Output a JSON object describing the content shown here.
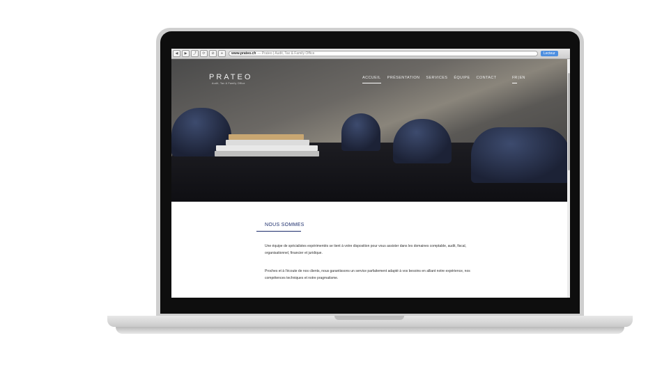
{
  "browser": {
    "url_site": "www.prateo.ch",
    "url_title": "— Prateo | Audit, Tax & Family Office",
    "reader_label": "Lecteur",
    "buttons": [
      "◀",
      "▶",
      "⤴",
      "⟳",
      "⊘",
      "+"
    ]
  },
  "site": {
    "logo": "PRATEO",
    "tagline": "Audit, Tax & Family Office",
    "nav": [
      "ACCUEIL",
      "PRÉSENTATION",
      "SERVICES",
      "ÉQUIPE",
      "CONTACT"
    ],
    "lang": {
      "fr": "FR",
      "sep": "|",
      "en": "EN"
    }
  },
  "content": {
    "section_title": "NOUS SOMMES",
    "paragraph_1": "Une équipe de spécialistes expérimentés se tient à votre disposition pour vous assister dans les domaines comptable, audit, fiscal, organisationnel, financier et juridique.",
    "paragraph_2": "Proches et à l'écoute de nos clients, nous garantissons un service parfaitement adapté à vos besoins en alliant notre expérience, nos compétences techniques et notre pragmatisme."
  },
  "colors": {
    "accent": "#1b2c6b",
    "reader_button": "#4d8fe0"
  },
  "icons": [
    "back-icon",
    "forward-icon",
    "share-icon",
    "reload-icon",
    "block-icon",
    "add-tab-icon"
  ]
}
